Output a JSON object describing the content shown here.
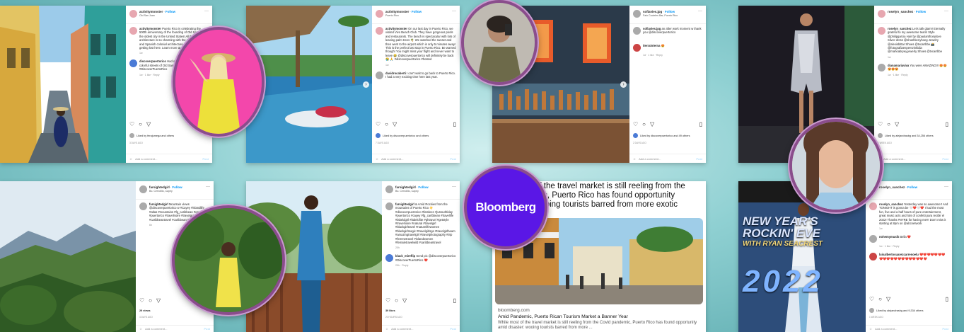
{
  "posts": {
    "p1": {
      "user": "activitymonster",
      "follow": "Follow",
      "location": "Old San Juan",
      "caption_user": "activitymonster",
      "caption": "Puerto Rico is celebrating the 500th anniversary of the founding of Old San Juan, the oldest city in the United States! All the architecture is so charming with the colorful houses and Spanish colonial architecture. I could spend getting lost here. Learn more at #discoverpuertorico",
      "caption_meta": "1w",
      "comment_user": "discoverpuertorico",
      "comment": "Had a great time exploring the colorful streets of Old San Juan ❤️📷 #DiscoverPuertoRico",
      "comment_meta": "1w · 1 like · Reply",
      "liked_by": "Liked by ferajumega and others",
      "posted": "3 days ago",
      "add_comment": "Add a comment...",
      "post": "Post"
    },
    "p2": {
      "user": "activitymonster",
      "follow": "Follow",
      "location": "Puerto Rico",
      "caption_user": "activitymonster",
      "caption": "On our last day in Puerto Rico, we visited Vivo Beach Club. They have gorgeous pools and restaurants. The beach is spectacular with lots of leaning palm trees 🌴 We watched the sunset and then went to the airport which is only 5 minutes away! This is the perfect last stop in Puerto Rico. Be warned though! You might miss your flight and never want to leave 😂 @discoverpuertorico will definitely be back 😭 🙏 #discoverpuertorico #hosted",
      "caption_meta": "1w",
      "comment_user": "davidrocaberti",
      "comment": "I can't wait to go back to Puerto Rico. I had a very exciting time here last year.",
      "liked_by": "Liked by discoverpuertorico and others",
      "posted": "7 days ago",
      "add_comment": "Add a comment...",
      "post": "Post"
    },
    "p3": {
      "user": "sofiavies.jpg",
      "follow": "Follow",
      "location": "Falo Cocteles Bar, Puerto Rico",
      "caption_user": "sofiavies.jpg",
      "caption": "an after work moment w thank you @discoverpuertorico",
      "comment_user": "tierrainterna",
      "comment": "😍",
      "comment_meta": "1d · 1 like · Reply",
      "liked_by": "Liked by discoverpuertorico and 49 others",
      "posted": "2 days ago",
      "add_comment": "Add a comment...",
      "post": "Post"
    },
    "p4": {
      "user": "roselyn_sanchez",
      "follow": "Follow",
      "location": "",
      "caption_user": "roselyn_sanchez",
      "caption": "Let's talk glam!! Eternally grateful to my awesome team! Style @philipgarcia Hair by @paulanthonylove  Silver dress @shushkenyhoeg Jewelry @alexisbittar Shoes @tvcarrbbe  📸 @fotografiaenperezinkidia @mahoabryey.jewelry Shoes @tvcarrbbe",
      "caption_meta": "1w",
      "comment_user": "dianamariaviva",
      "comment": "You were AMAZING!!! 😍😍😍😍😍",
      "comment_meta": "1w · 1 like · Reply",
      "liked_by": "Liked by alejandrasbg and 34,256 others",
      "posted": "1 week ago",
      "add_comment": "Add a comment...",
      "post": "Post"
    },
    "p5": {
      "user": "farsightedgirl",
      "follow": "Follow",
      "location": "Bo. Cerrolillo, Cayey",
      "caption_user": "farsightedgirl",
      "caption": "Mountain views @discoverpuertorico w #Cayey #islandlife #atlas #mountains #fg_caribbean #cayey #puertorico #travelnoire #travelgram #caribbeantravel #caribbean #puertorico",
      "caption_meta": "6h",
      "views": "29 views",
      "posted": "4 days ago",
      "add_comment": "Add a comment...",
      "post": "Post"
    },
    "p6": {
      "user": "farsightedgirl",
      "follow": "Follow",
      "location": "Bo. Cerrolillo, Cayey",
      "caption_user": "farsightedgirl",
      "caption": "& Amid Rockies from the mountains of Puerto Rico ☀️ #discoverpuertorico #farsleen #justoutfriday #puertorico #cayey #fg_caribbean #travellife #labeldgirl #labelofite #ghtravel #getstyle #travelnoire #natural #travelgirl #blackgirltravel #naturelifewomen #blackgirlmagic #travelgirlsgo #travelgirlbeam #amazingtravelgirl #travelphotography #trip #femmetravel #islandwomen #femaletravelwild #caribbeantravel",
      "caption_meta": "25h",
      "comment_user": "black_mireflip",
      "comment": "Send pic @discoverpuertorico #DiscoverPuertoRico ❤️",
      "comment_meta": "25h · Reply",
      "likes": "39 likes",
      "posted": "20 hours ago",
      "add_comment": "Add a comment...",
      "post": "Post"
    },
    "p7": {
      "user": "roselyn_sanchez",
      "follow": "Follow",
      "location": "",
      "caption_user": "roselyn_sanchez",
      "caption": "Yesterday was so awesome!! And TONIGHT is gonna be 🤍❤️🤍❤️ I had the most fun, five and a half hours of pure entertainment, great music acts and lots of confetti para recibir el 2022! Thanks #NYRE for having me!!! Don't miss it starting at 8pm on @abcnetwork",
      "caption_meta": "1w",
      "comment_user": "nohemymusik",
      "comment": "Bella ❤️",
      "comment_meta": "1w · 1 like · Reply",
      "comment2_user": "luisalbertosuarezcarrenoelu",
      "comment2": "❤️❤️❤️❤️❤️❤️❤️❤️❤️❤️❤️❤️❤️❤️❤️❤️❤️❤️❤️❤️",
      "liked_by": "Liked by alejandrasbg and 9,334 others",
      "posted": "1 week ago",
      "add_comment": "Add a comment...",
      "post": "Post"
    }
  },
  "text_post": {
    "headline_line1": "of the travel market is still reeling from the",
    "headline_line2": "mic, Puerto Rico has found opportunity",
    "headline_line3": "wooing tourists barred from more exotic",
    "domain": "bloomberg.com",
    "title": "Amid Pandemic, Puerto Rican Tourism Market a Banner Year",
    "desc": "While most of the travel market is still reeling from the Covid pandemic, Puerto Rico has found opportunity amid disaster: wooing tourists barred from more ..."
  },
  "bloomberg_logo": "Bloomberg",
  "new_year_text": {
    "line1": "NEW YEAR'S",
    "line2": "ROCKIN' EVE",
    "line3": "WITH RYAN SEACREST",
    "year": "2022"
  },
  "colors": {
    "accent": "#0095f6",
    "frame": "#8a4d8c",
    "bloomberg": "#5a17e6",
    "background": "#8fd0d2"
  }
}
